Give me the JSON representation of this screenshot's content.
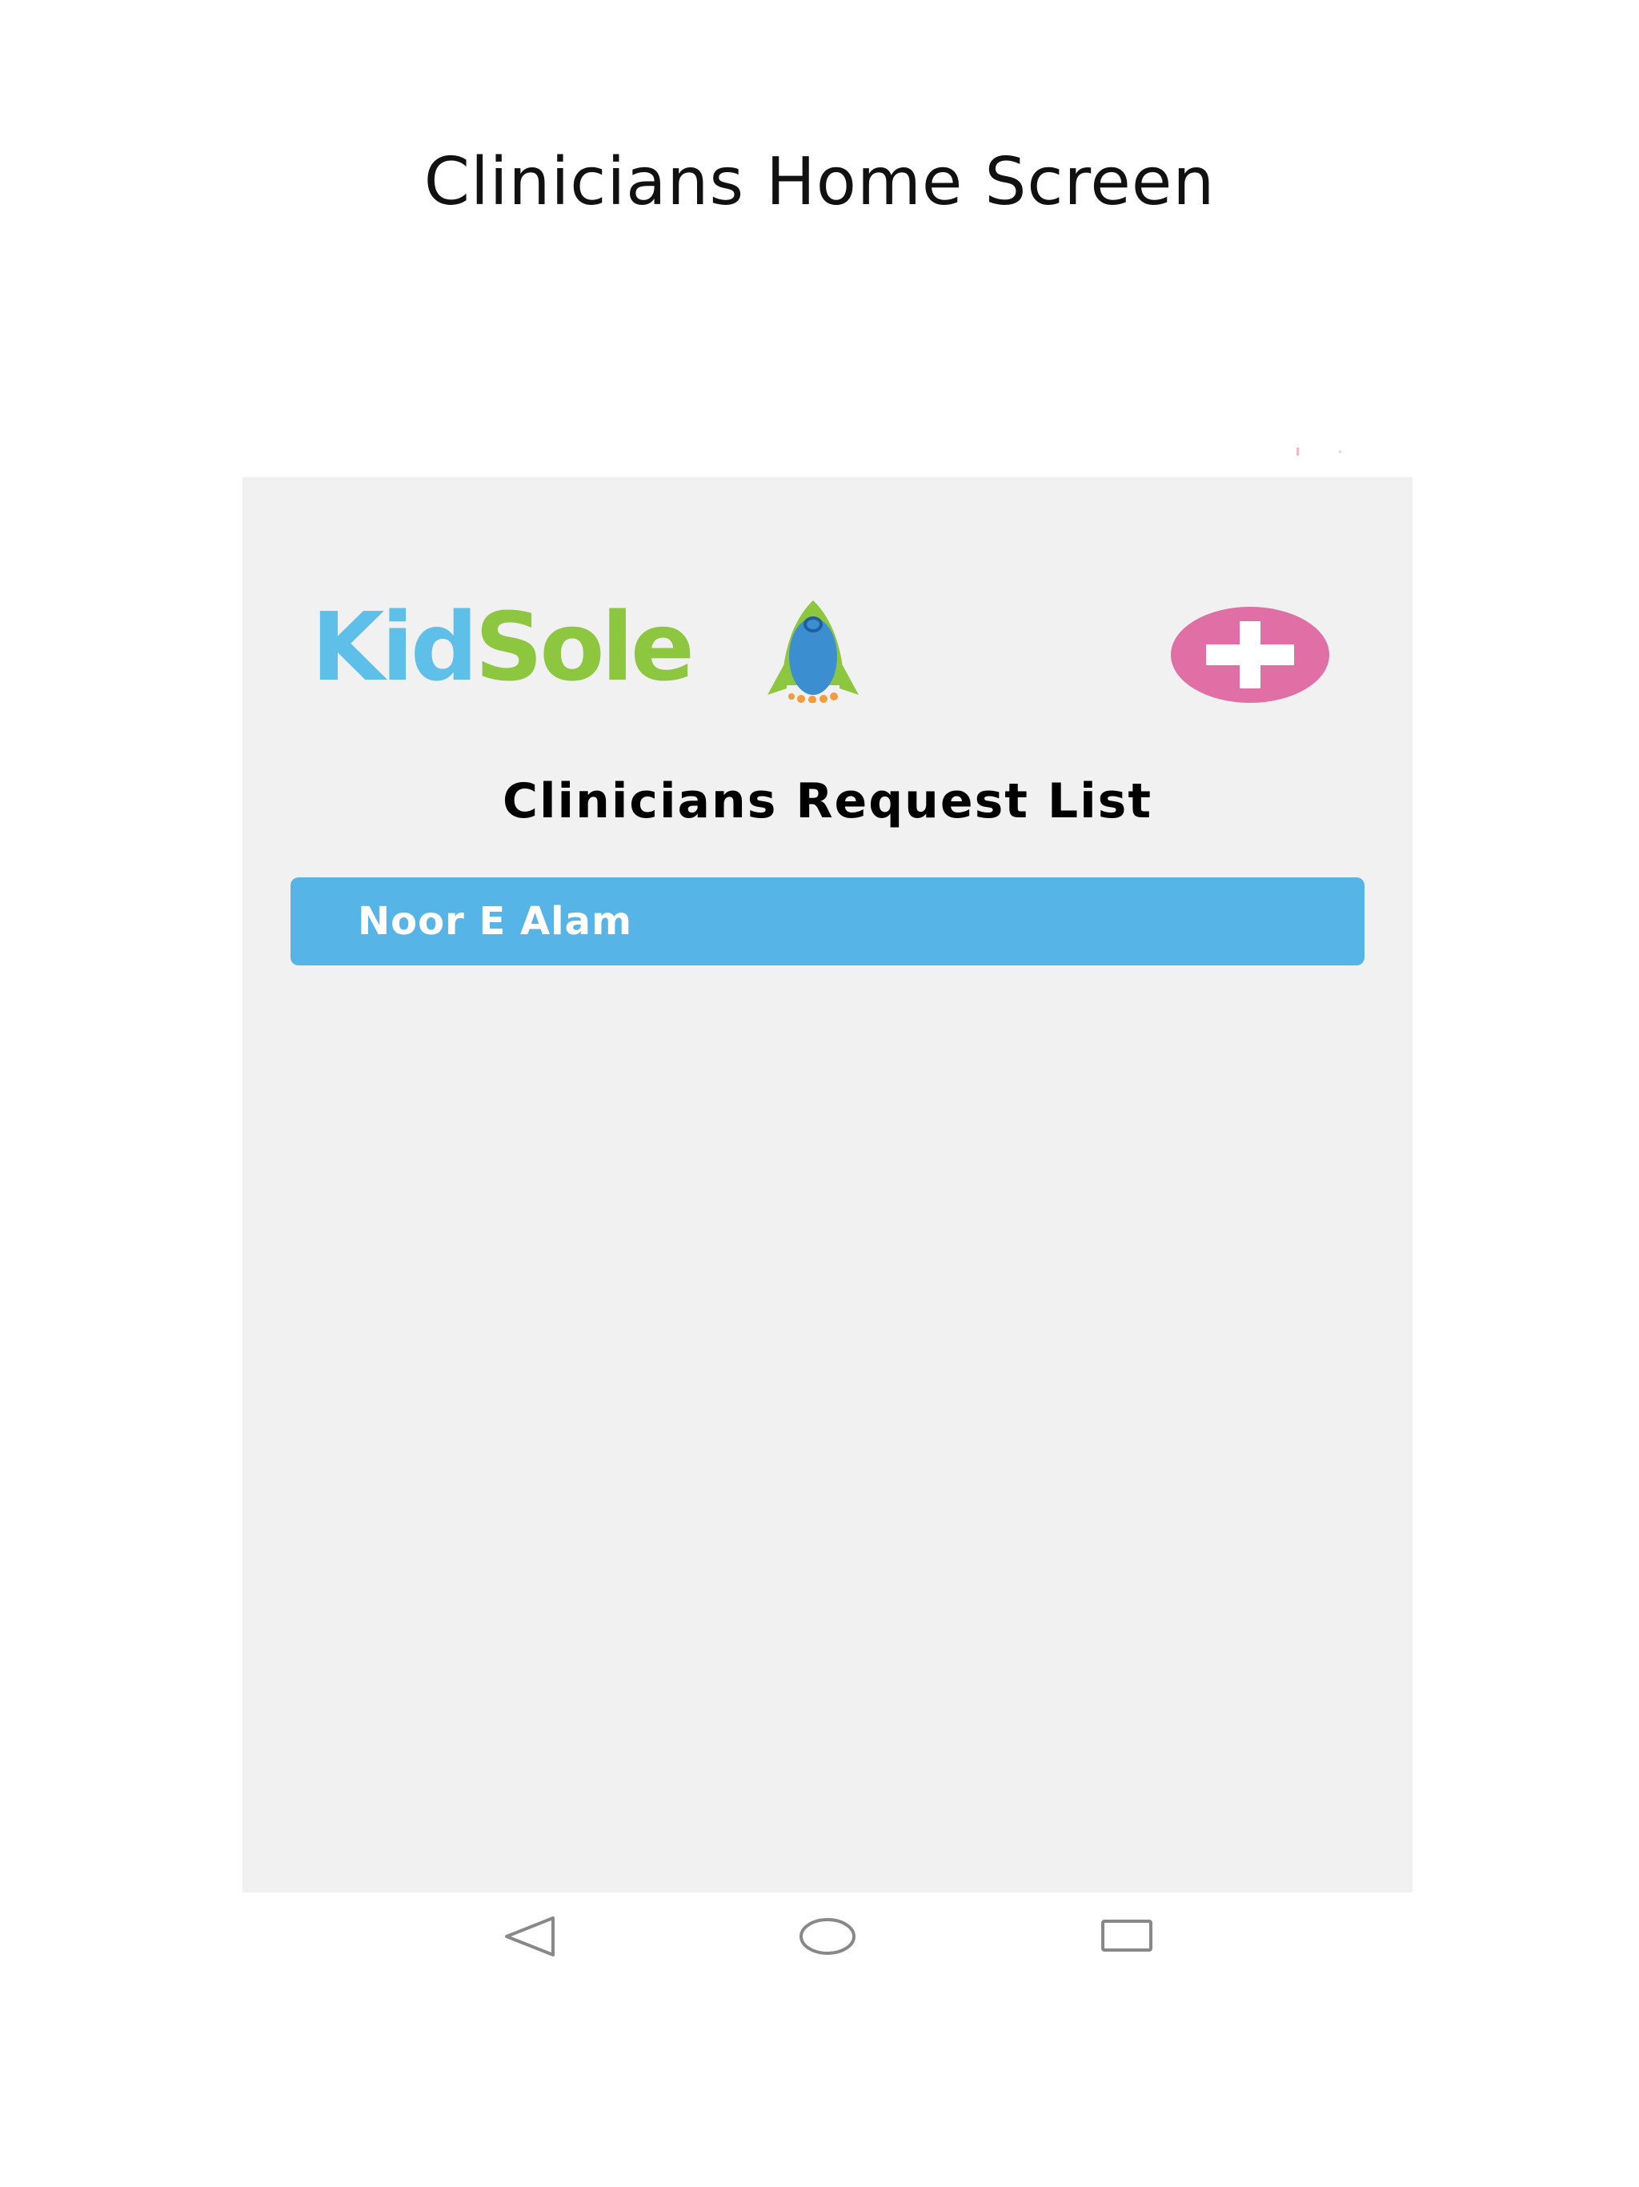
{
  "page": {
    "heading": "Clinicians Home Screen"
  },
  "app": {
    "logo": {
      "text_part1": "Kid",
      "text_part2": "Sole"
    },
    "add_button_icon": "plus-icon",
    "list_title": "Clinicians Request List",
    "requests": [
      {
        "name": "Noor E Alam"
      }
    ]
  },
  "navigation": {
    "back_icon": "back-triangle-icon",
    "home_icon": "home-circle-icon",
    "recents_icon": "recents-square-icon"
  },
  "colors": {
    "screen_background": "#f1f1f1",
    "accent_blue": "#56b5e6",
    "accent_pink": "#e06fa6",
    "logo_kid": "#5ec0e8",
    "logo_sole": "#8dc63f",
    "logo_foot": "#3b8fd0",
    "logo_rocket": "#8dc63f",
    "logo_toes": "#f39c3c"
  }
}
